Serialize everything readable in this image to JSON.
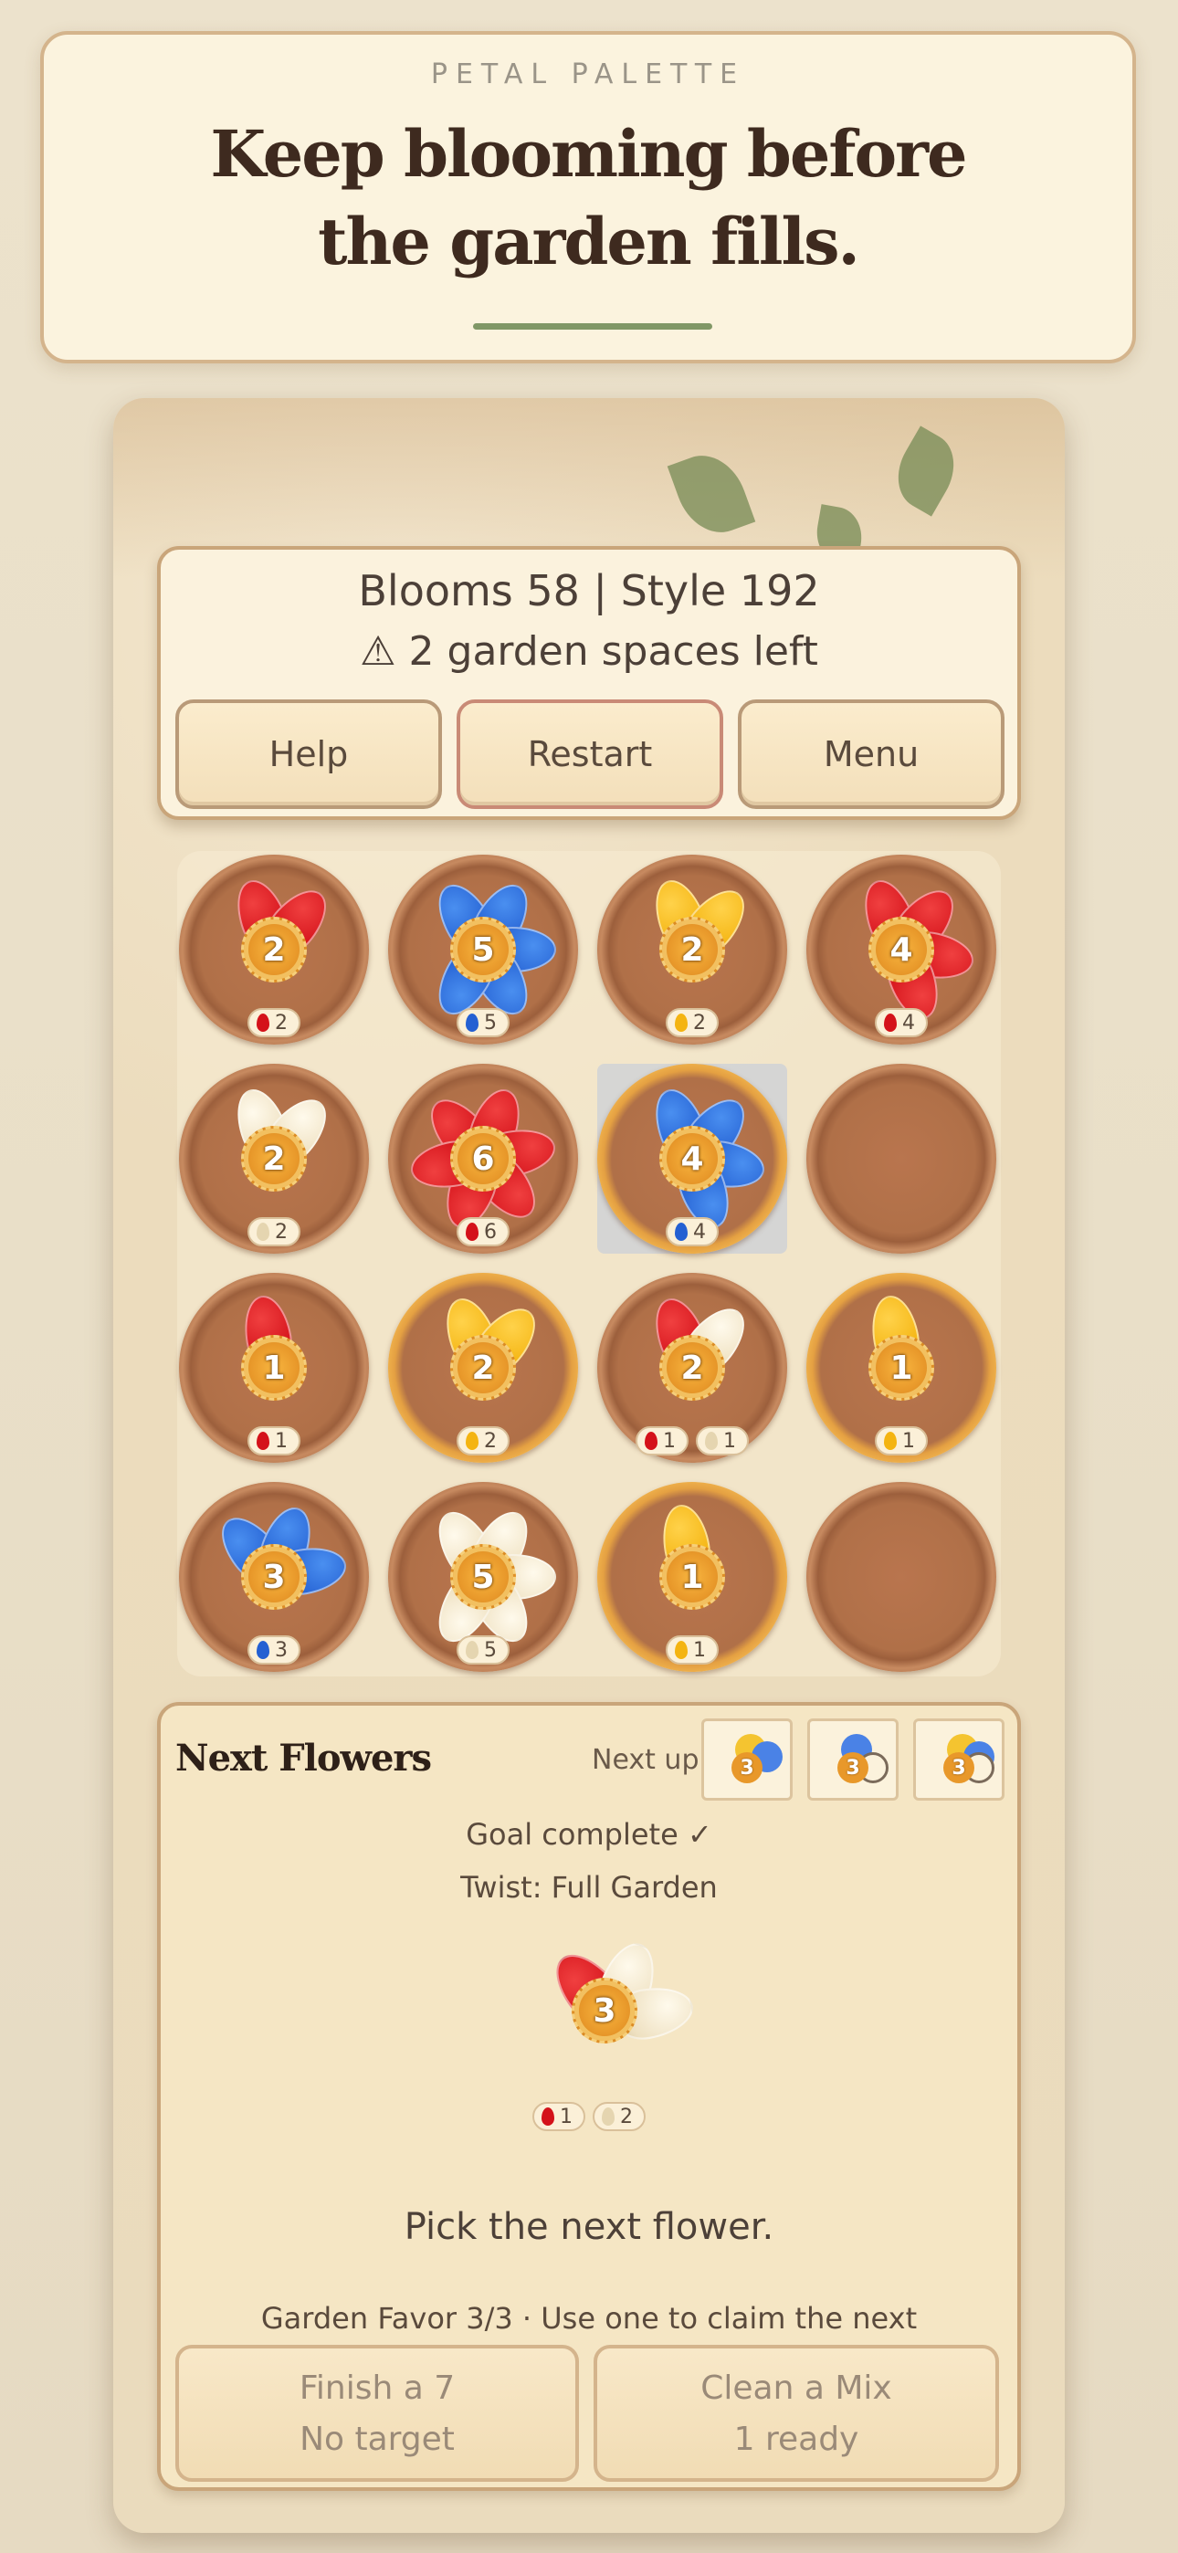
{
  "banner": {
    "eyebrow": "PETAL PALETTE",
    "headline": "Keep blooming before the garden fills."
  },
  "stats": {
    "score_line": "Blooms 58 | Style 192",
    "warning": "⚠ 2 garden spaces left"
  },
  "buttons": {
    "help": "Help",
    "restart": "Restart",
    "menu": "Menu"
  },
  "garden": [
    {
      "petals": [
        "red",
        "red"
      ],
      "count": "2",
      "chips": [
        {
          "color": "red",
          "n": "2"
        }
      ],
      "gold": false
    },
    {
      "petals": [
        "blue",
        "blue",
        "blue",
        "blue",
        "blue"
      ],
      "count": "5",
      "chips": [
        {
          "color": "blue",
          "n": "5"
        }
      ],
      "gold": false
    },
    {
      "petals": [
        "yellow",
        "yellow"
      ],
      "count": "2",
      "chips": [
        {
          "color": "yellow",
          "n": "2"
        }
      ],
      "gold": false
    },
    {
      "petals": [
        "red",
        "red",
        "red",
        "red"
      ],
      "count": "4",
      "chips": [
        {
          "color": "red",
          "n": "4"
        }
      ],
      "gold": false
    },
    {
      "petals": [
        "white",
        "white"
      ],
      "count": "2",
      "chips": [
        {
          "color": "white",
          "n": "2"
        }
      ],
      "gold": false
    },
    {
      "petals": [
        "red",
        "red",
        "red",
        "red",
        "red",
        "red"
      ],
      "count": "6",
      "chips": [
        {
          "color": "red",
          "n": "6"
        }
      ],
      "gold": false
    },
    {
      "petals": [
        "blue",
        "blue",
        "blue",
        "blue"
      ],
      "count": "4",
      "chips": [
        {
          "color": "blue",
          "n": "4"
        }
      ],
      "gold": true,
      "selected": true
    },
    {
      "petals": [],
      "count": "",
      "chips": [],
      "gold": false
    },
    {
      "petals": [
        "red"
      ],
      "count": "1",
      "chips": [
        {
          "color": "red",
          "n": "1"
        }
      ],
      "gold": false
    },
    {
      "petals": [
        "yellow",
        "yellow"
      ],
      "count": "2",
      "chips": [
        {
          "color": "yellow",
          "n": "2"
        }
      ],
      "gold": true
    },
    {
      "petals": [
        "red",
        "white"
      ],
      "count": "2",
      "chips": [
        {
          "color": "red",
          "n": "1"
        },
        {
          "color": "white",
          "n": "1"
        }
      ],
      "gold": false
    },
    {
      "petals": [
        "yellow"
      ],
      "count": "1",
      "chips": [
        {
          "color": "yellow",
          "n": "1"
        }
      ],
      "gold": true
    },
    {
      "petals": [
        "blue",
        "blue",
        "blue"
      ],
      "count": "3",
      "chips": [
        {
          "color": "blue",
          "n": "3"
        }
      ],
      "gold": false
    },
    {
      "petals": [
        "white",
        "white",
        "white",
        "white",
        "white"
      ],
      "count": "5",
      "chips": [
        {
          "color": "white",
          "n": "5"
        }
      ],
      "gold": false
    },
    {
      "petals": [
        "yellow"
      ],
      "count": "1",
      "chips": [
        {
          "color": "yellow",
          "n": "1"
        }
      ],
      "gold": true
    },
    {
      "petals": [],
      "count": "",
      "chips": [],
      "gold": false
    }
  ],
  "next": {
    "title": "Next Flowers",
    "next_up_label": "Next up",
    "previews": [
      {
        "count": "3",
        "colors": [
          "yellow",
          "blue"
        ],
        "ring": false
      },
      {
        "count": "3",
        "colors": [
          "blue"
        ],
        "ring": true
      },
      {
        "count": "3",
        "colors": [
          "yellow",
          "blue"
        ],
        "ring": true
      }
    ],
    "goal": "Goal complete ✓",
    "twist": "Twist: Full Garden",
    "current": {
      "count": "3",
      "petals": [
        "red",
        "white",
        "white"
      ],
      "chips": [
        {
          "color": "red",
          "n": "1"
        },
        {
          "color": "white",
          "n": "2"
        }
      ]
    },
    "prompt": "Pick the next flower.",
    "favor": "Garden Favor 3/3 · Use one to claim the next",
    "finish": {
      "line1": "Finish a 7",
      "line2": "No target"
    },
    "clean": {
      "line1": "Clean a Mix",
      "line2": "1 ready"
    }
  }
}
